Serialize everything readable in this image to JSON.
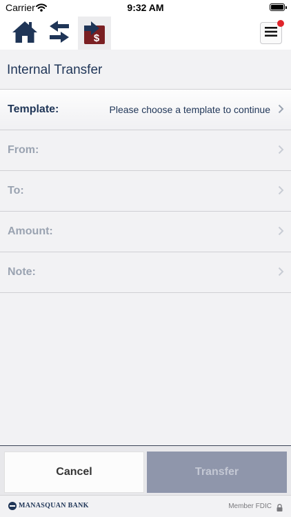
{
  "status_bar": {
    "carrier": "Carrier",
    "time": "9:32 AM"
  },
  "nav": {
    "icons": [
      "home-icon",
      "transfers-icon",
      "pay-bill-icon"
    ],
    "active": "pay-bill-icon",
    "menu_icon": "hamburger-menu-icon",
    "has_notification": true
  },
  "page": {
    "title": "Internal Transfer"
  },
  "form": {
    "rows": [
      {
        "label": "Template:",
        "value": "Please choose a template to continue",
        "enabled": true
      },
      {
        "label": "From:",
        "value": "",
        "enabled": false
      },
      {
        "label": "To:",
        "value": "",
        "enabled": false
      },
      {
        "label": "Amount:",
        "value": "",
        "enabled": false
      },
      {
        "label": "Note:",
        "value": "",
        "enabled": false
      }
    ]
  },
  "actions": {
    "cancel_label": "Cancel",
    "transfer_label": "Transfer"
  },
  "footer": {
    "bank_name": "MANASQUAN BANK",
    "member_text": "Member FDIC"
  },
  "colors": {
    "navy": "#1f3557",
    "maroon": "#7a1f22",
    "disabled_button": "#8f96ab",
    "notification": "#e0242b"
  }
}
